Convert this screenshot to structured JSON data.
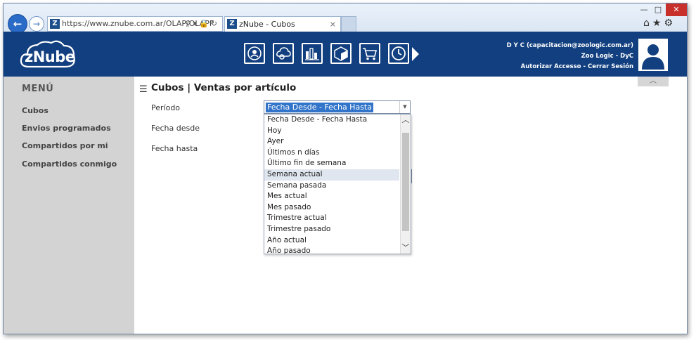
{
  "browser": {
    "url": "https://www.znube.com.ar/OLAP/OLAPF",
    "url_icons": [
      "search-icon",
      "dropdown-icon",
      "lock-icon",
      "refresh-icon"
    ],
    "tab_title": "zNube - Cubos",
    "tab_close": "×",
    "toolbar_icons": [
      "home-icon",
      "star-icon",
      "gear-icon"
    ],
    "window_buttons": {
      "minimize": "—",
      "maximize": "□",
      "close": "✕"
    }
  },
  "header": {
    "logo_text": "zNube",
    "modules": [
      "cloud-people-icon",
      "cloud-gear-icon",
      "chart-icon",
      "cube-icon",
      "cart-icon",
      "clock-icon"
    ],
    "user_name": "D Y C (capacitacion@zoologic.com.ar)",
    "company": "Zoo Logic - DyC",
    "link_authorize": "Autorizar Accesso",
    "separator": "-",
    "link_logout": "Cerrar Sesión"
  },
  "sidebar": {
    "title": "MENÚ",
    "items": [
      {
        "label": "Cubos"
      },
      {
        "label": "Envios programados"
      },
      {
        "label": "Compartidos por mi"
      },
      {
        "label": "Compartidos conmigo"
      }
    ]
  },
  "main": {
    "title": "Cubos | Ventas por artículo",
    "fields": [
      {
        "label": "Período"
      },
      {
        "label": "Fecha desde"
      },
      {
        "label": "Fecha hasta"
      }
    ],
    "select_value": "Fecha Desde - Fecha Hasta",
    "collapse_glyph": "︿"
  },
  "dropdown": {
    "options": [
      "Fecha Desde - Fecha Hasta",
      "Hoy",
      "Ayer",
      "Últimos n días",
      "Último fin de semana",
      "Semana actual",
      "Semana pasada",
      "Mes actual",
      "Mes pasado",
      "Trimestre actual",
      "Trimestre pasado",
      "Año actual",
      "Año pasado"
    ],
    "highlighted_index": 5,
    "selected_index": 0,
    "scroll_up": "︿",
    "scroll_down": "﹀"
  }
}
